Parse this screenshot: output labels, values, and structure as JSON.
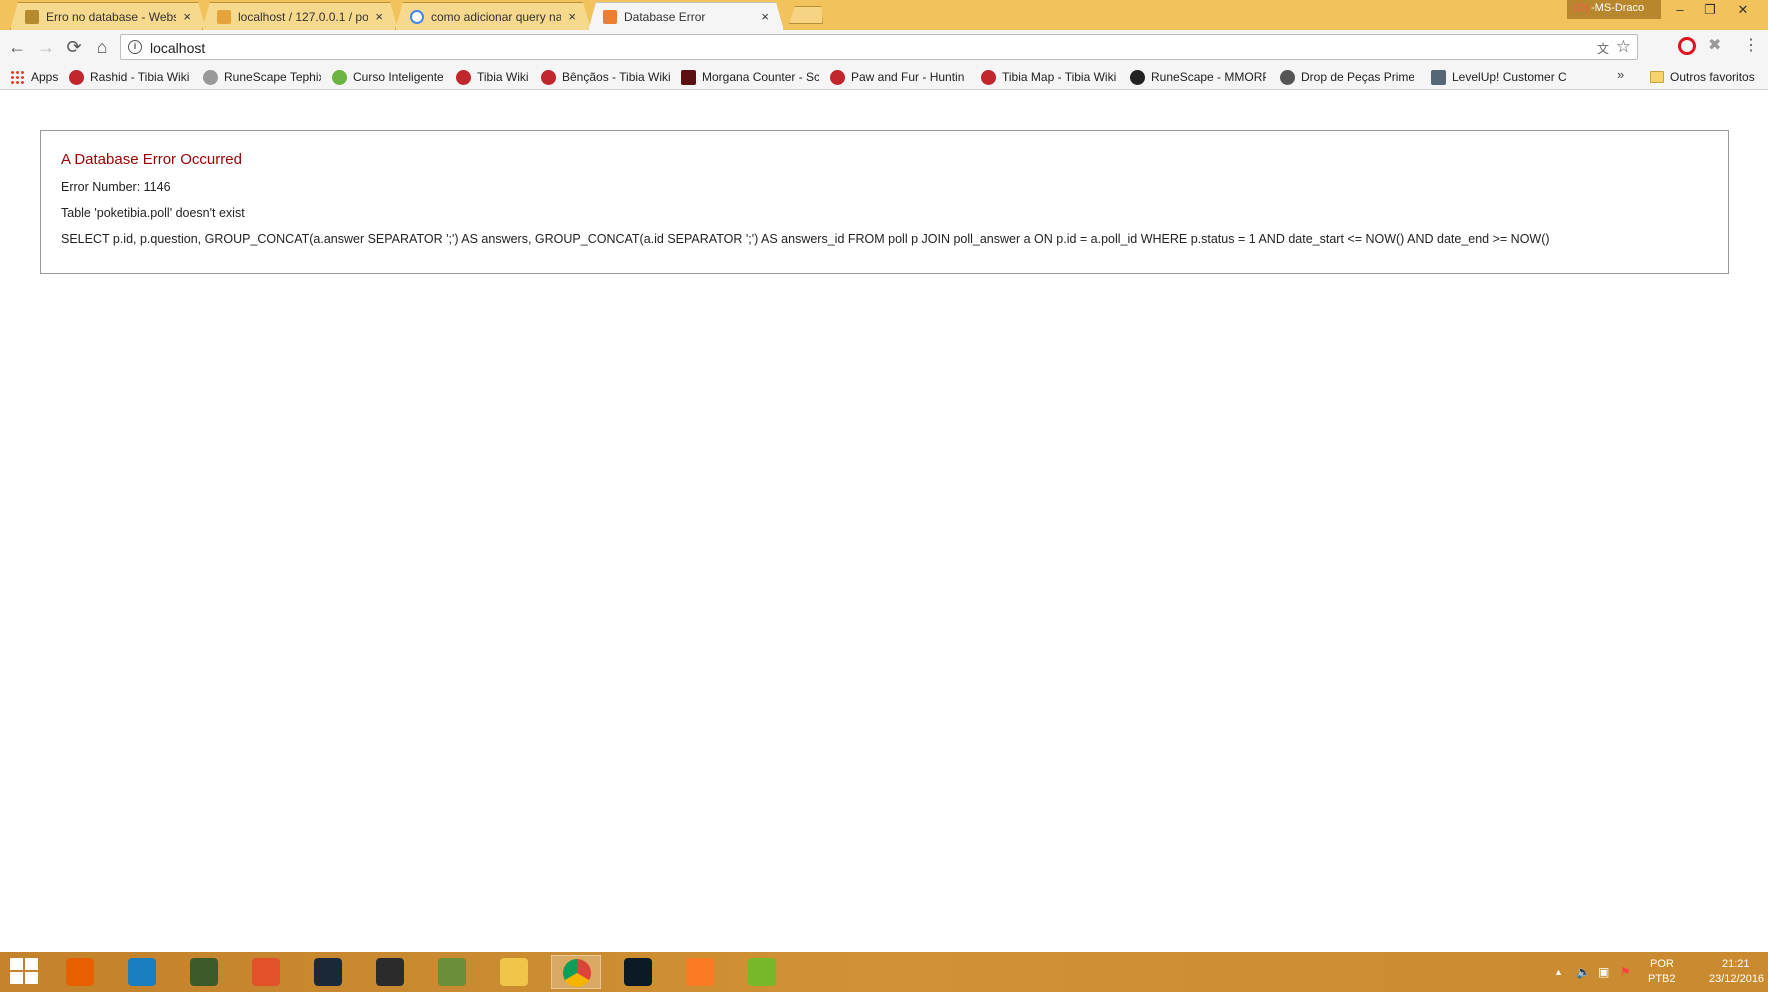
{
  "tabs": [
    {
      "label": "Erro no database - Webs",
      "favicon_color": "#b58a2c",
      "active": false
    },
    {
      "label": "localhost / 127.0.0.1 / po",
      "favicon_color": "#e5a33b",
      "active": false
    },
    {
      "label": "como adicionar query na",
      "favicon_color": "#4285f4",
      "active": false
    },
    {
      "label": "Database Error",
      "favicon_color": "#ef7d2f",
      "active": true
    }
  ],
  "tab_close_glyph": "×",
  "profile_name": "-MS-Draco",
  "window_controls": {
    "minimize": "–",
    "restore": "❐",
    "close": "✕"
  },
  "toolbar": {
    "back_glyph": "←",
    "forward_glyph": "→",
    "reload_glyph": "⟳",
    "home_glyph": "⌂",
    "url": "localhost",
    "info_glyph": "i",
    "translate_glyph": "文",
    "star_glyph": "☆",
    "ext_glyph": "✖",
    "menu_glyph": "⋮"
  },
  "bookmarks": [
    {
      "label": "Apps",
      "icon": "apps-grid-icon",
      "color": "#e23d28"
    },
    {
      "label": "Rashid - Tibia Wiki",
      "icon": "tibia-icon",
      "color": "#c0262c"
    },
    {
      "label": "RuneScape Tephix",
      "icon": "sword-icon",
      "color": "#777777"
    },
    {
      "label": "Curso Inteligente",
      "icon": "puzzle-icon",
      "color": "#6cb33f"
    },
    {
      "label": "Tibia Wiki",
      "icon": "tibia-icon",
      "color": "#c0262c"
    },
    {
      "label": "Bênçãos - Tibia Wiki",
      "icon": "tibia-icon",
      "color": "#c0262c"
    },
    {
      "label": "Morgana Counter - Sc",
      "icon": "morgana-icon",
      "color": "#5a1010"
    },
    {
      "label": "Paw and Fur - Huntin",
      "icon": "tibia-icon",
      "color": "#c0262c"
    },
    {
      "label": "Tibia Map - Tibia Wiki",
      "icon": "tibia-icon",
      "color": "#c0262c"
    },
    {
      "label": "RuneScape - MMORP",
      "icon": "runescape-icon",
      "color": "#222222"
    },
    {
      "label": "Drop de Peças Prime",
      "icon": "gear-icon",
      "color": "#555555"
    },
    {
      "label": "LevelUp! Customer Ca",
      "icon": "levelup-icon",
      "color": "#556677"
    }
  ],
  "bookmarks_more": "»",
  "bookmarks_folder": "Outros favoritos",
  "error": {
    "title": "A Database Error Occurred",
    "number": "Error Number: 1146",
    "message": "Table 'poketibia.poll' doesn't exist",
    "query": "SELECT p.id, p.question, GROUP_CONCAT(a.answer SEPARATOR ';') AS answers, GROUP_CONCAT(a.id SEPARATOR ';') AS answers_id FROM poll p JOIN poll_answer a ON p.id = a.poll_id WHERE p.status = 1 AND date_start <= NOW() AND date_end >= NOW()"
  },
  "taskbar": {
    "apps": [
      {
        "name": "firefox-icon",
        "color": "#e66000",
        "active": false
      },
      {
        "name": "cortana-c-icon",
        "color": "#1a7fc1",
        "active": false
      },
      {
        "name": "tibia-game-icon",
        "color": "#3d5a2a",
        "active": false
      },
      {
        "name": "pin-icon",
        "color": "#e2522a",
        "active": false
      },
      {
        "name": "steam-icon",
        "color": "#1b2838",
        "active": false
      },
      {
        "name": "nox-icon",
        "color": "#2b2b2b",
        "active": false
      },
      {
        "name": "minecraft-icon",
        "color": "#6b8e3a",
        "active": false
      },
      {
        "name": "file-explorer-icon",
        "color": "#f0c64a",
        "active": false
      },
      {
        "name": "chrome-icon",
        "color": "#4285f4",
        "active": true
      },
      {
        "name": "league-icon",
        "color": "#0b1a24",
        "active": false
      },
      {
        "name": "xampp-icon",
        "color": "#fb7a24",
        "active": false
      },
      {
        "name": "utorrent-icon",
        "color": "#76b82a",
        "active": false
      }
    ],
    "lang_line1": "POR",
    "lang_line2": "PTB2",
    "time": "21:21",
    "date": "23/12/2016",
    "tray_up_glyph": "▲",
    "tray_volume_glyph": "🔈",
    "tray_network_glyph": "▣",
    "tray_flag_glyph": "⚑"
  }
}
